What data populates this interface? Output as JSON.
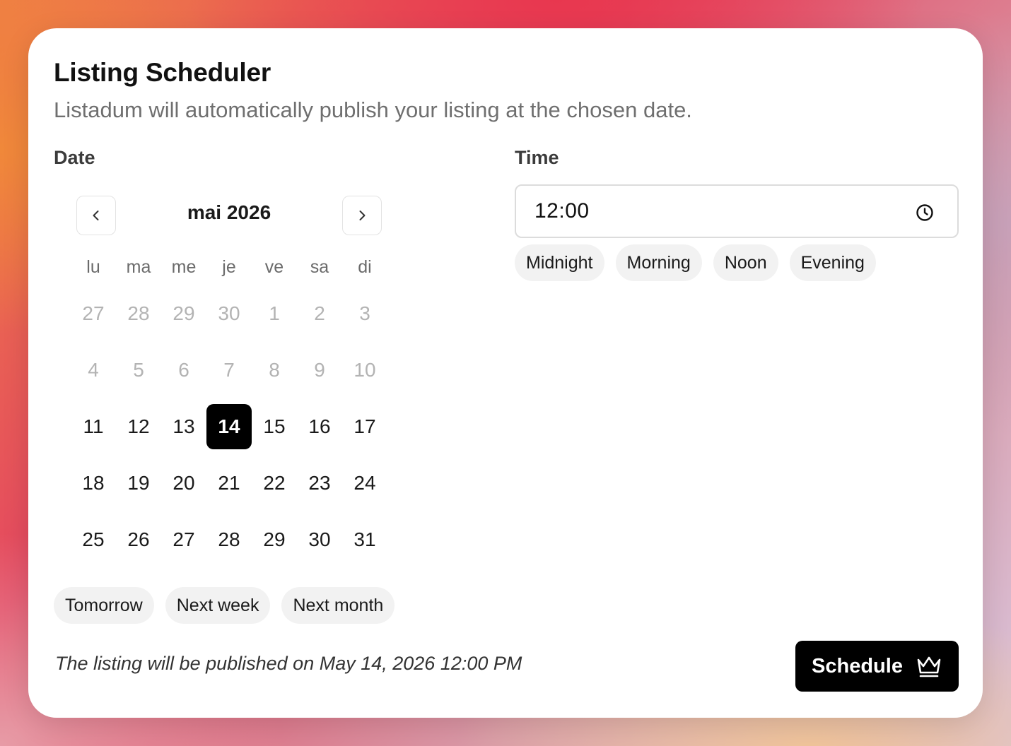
{
  "header": {
    "title": "Listing Scheduler",
    "subtitle": "Listadum will automatically publish your listing at the chosen date."
  },
  "date": {
    "label": "Date",
    "month": "mai 2026",
    "weekdays": [
      "lu",
      "ma",
      "me",
      "je",
      "ve",
      "sa",
      "di"
    ],
    "weeks": [
      [
        {
          "d": "27",
          "muted": true
        },
        {
          "d": "28",
          "muted": true
        },
        {
          "d": "29",
          "muted": true
        },
        {
          "d": "30",
          "muted": true
        },
        {
          "d": "1",
          "muted": true
        },
        {
          "d": "2",
          "muted": true
        },
        {
          "d": "3",
          "muted": true
        }
      ],
      [
        {
          "d": "4",
          "muted": true
        },
        {
          "d": "5",
          "muted": true
        },
        {
          "d": "6",
          "muted": true
        },
        {
          "d": "7",
          "muted": true
        },
        {
          "d": "8",
          "muted": true
        },
        {
          "d": "9",
          "muted": true
        },
        {
          "d": "10",
          "muted": true
        }
      ],
      [
        {
          "d": "11"
        },
        {
          "d": "12"
        },
        {
          "d": "13"
        },
        {
          "d": "14",
          "selected": true
        },
        {
          "d": "15"
        },
        {
          "d": "16"
        },
        {
          "d": "17"
        }
      ],
      [
        {
          "d": "18"
        },
        {
          "d": "19"
        },
        {
          "d": "20"
        },
        {
          "d": "21"
        },
        {
          "d": "22"
        },
        {
          "d": "23"
        },
        {
          "d": "24"
        }
      ],
      [
        {
          "d": "25"
        },
        {
          "d": "26"
        },
        {
          "d": "27"
        },
        {
          "d": "28"
        },
        {
          "d": "29"
        },
        {
          "d": "30"
        },
        {
          "d": "31"
        }
      ]
    ],
    "quick_picks": [
      "Tomorrow",
      "Next week",
      "Next month"
    ]
  },
  "time": {
    "label": "Time",
    "value": "12:00",
    "quick_picks": [
      "Midnight",
      "Morning",
      "Noon",
      "Evening"
    ]
  },
  "footer": {
    "summary": "The listing will be published on May 14, 2026 12:00 PM",
    "schedule_label": "Schedule"
  },
  "icons": {
    "prev": "chevron-left-icon",
    "next": "chevron-right-icon",
    "clock": "clock-icon",
    "crown": "crown-icon"
  },
  "colors": {
    "selected_bg": "#000000",
    "muted_day": "#b3b3b3",
    "chip_bg": "#f2f2f2"
  }
}
